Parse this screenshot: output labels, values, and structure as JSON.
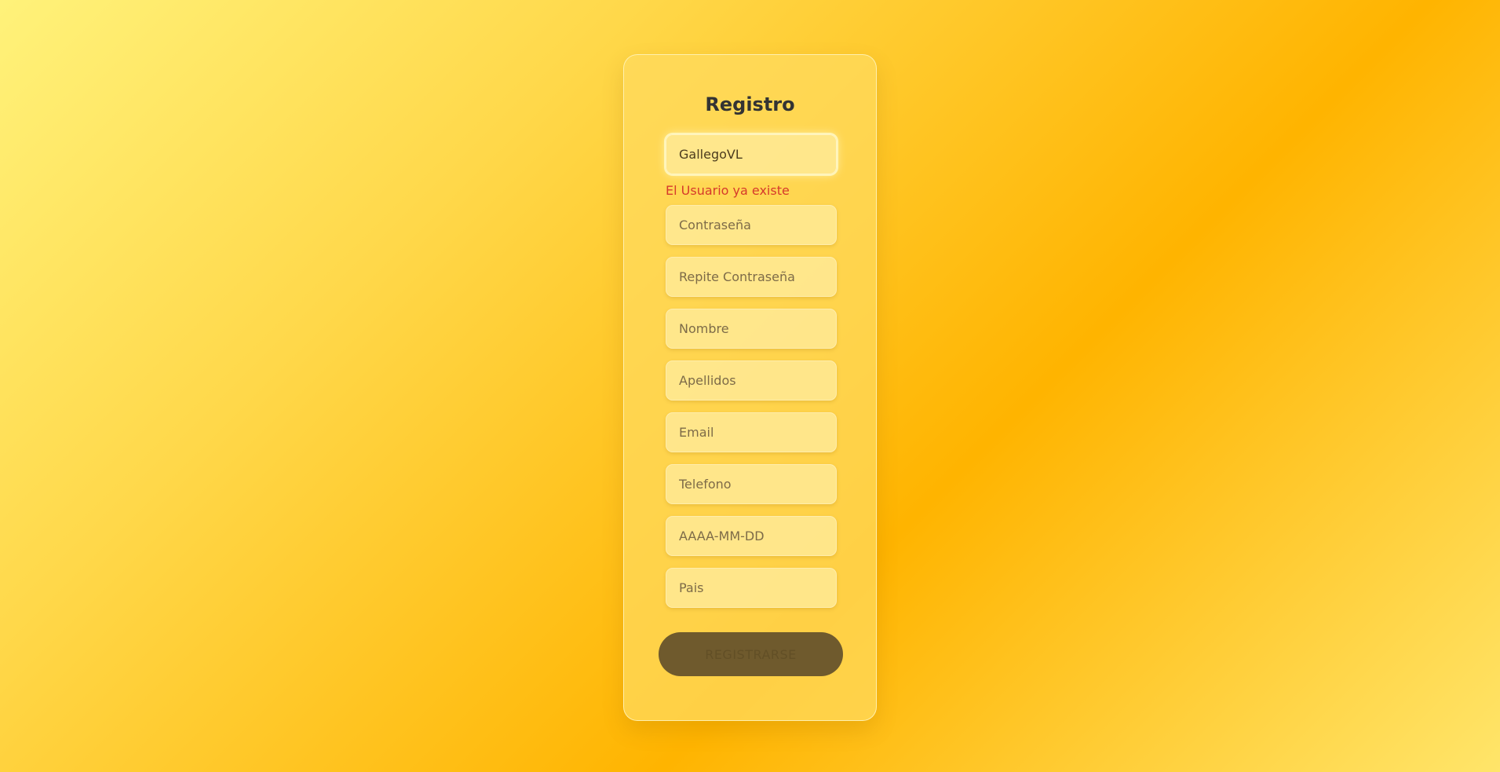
{
  "form": {
    "title": "Registro",
    "username_value": "GallegoVL",
    "username_error": "El Usuario ya existe",
    "password_placeholder": "Contraseña",
    "repeat_password_placeholder": "Repite Contraseña",
    "name_placeholder": "Nombre",
    "surnames_placeholder": "Apellidos",
    "email_placeholder": "Email",
    "phone_placeholder": "Telefono",
    "birthdate_placeholder": "AAAA-MM-DD",
    "country_placeholder": "Pais",
    "submit_label": "REGISTRARSE"
  },
  "colors": {
    "error": "#d63a2b",
    "button": "#6f5a2d"
  }
}
